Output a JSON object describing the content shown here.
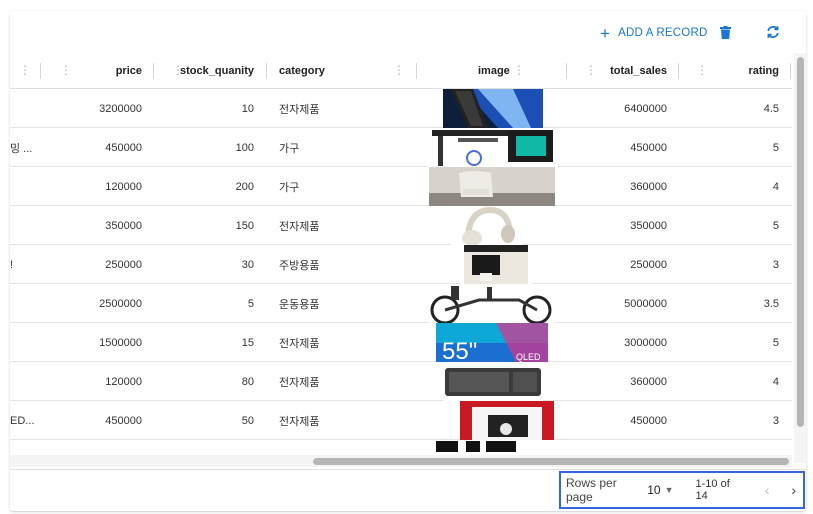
{
  "toolbar": {
    "add_label": "ADD A RECORD",
    "delete_icon": "trash-icon",
    "refresh_icon": "refresh-icon",
    "accent_color": "#1976d2"
  },
  "columns": {
    "price": "price",
    "stock": "stock_quanity",
    "category": "category",
    "image": "image",
    "total_sales": "total_sales",
    "rating": "rating"
  },
  "rows": [
    {
      "name": "",
      "price": "3200000",
      "stock": "10",
      "category": "전자제품",
      "total_sales": "6400000",
      "rating": "4.5",
      "image": "laptop"
    },
    {
      "name": "밍 ...",
      "price": "450000",
      "stock": "100",
      "category": "가구",
      "total_sales": "450000",
      "rating": "5",
      "image": "gaming-desk"
    },
    {
      "name": "",
      "price": "120000",
      "stock": "200",
      "category": "가구",
      "total_sales": "360000",
      "rating": "4",
      "image": "armchair"
    },
    {
      "name": "",
      "price": "350000",
      "stock": "150",
      "category": "전자제품",
      "total_sales": "350000",
      "rating": "5",
      "image": "headphones"
    },
    {
      "name": "!",
      "price": "250000",
      "stock": "30",
      "category": "주방용품",
      "total_sales": "250000",
      "rating": "3",
      "image": "coffee-machine"
    },
    {
      "name": "",
      "price": "2500000",
      "stock": "5",
      "category": "운동용품",
      "total_sales": "5000000",
      "rating": "3.5",
      "image": "cargo-bike"
    },
    {
      "name": "",
      "price": "1500000",
      "stock": "15",
      "category": "전자제품",
      "total_sales": "3000000",
      "rating": "5",
      "image": "qled-tv"
    },
    {
      "name": "",
      "price": "120000",
      "stock": "80",
      "category": "전자제품",
      "total_sales": "360000",
      "rating": "4",
      "image": "keyboard"
    },
    {
      "name": "ED...",
      "price": "450000",
      "stock": "50",
      "category": "전자제품",
      "total_sales": "450000",
      "rating": "3",
      "image": "game-console"
    }
  ],
  "tv_text": "55\"",
  "tv_brand": "QLED",
  "pagination": {
    "rows_per_page_label": "Rows per page",
    "rows_per_page": "10",
    "range": "1-10 of 14"
  }
}
